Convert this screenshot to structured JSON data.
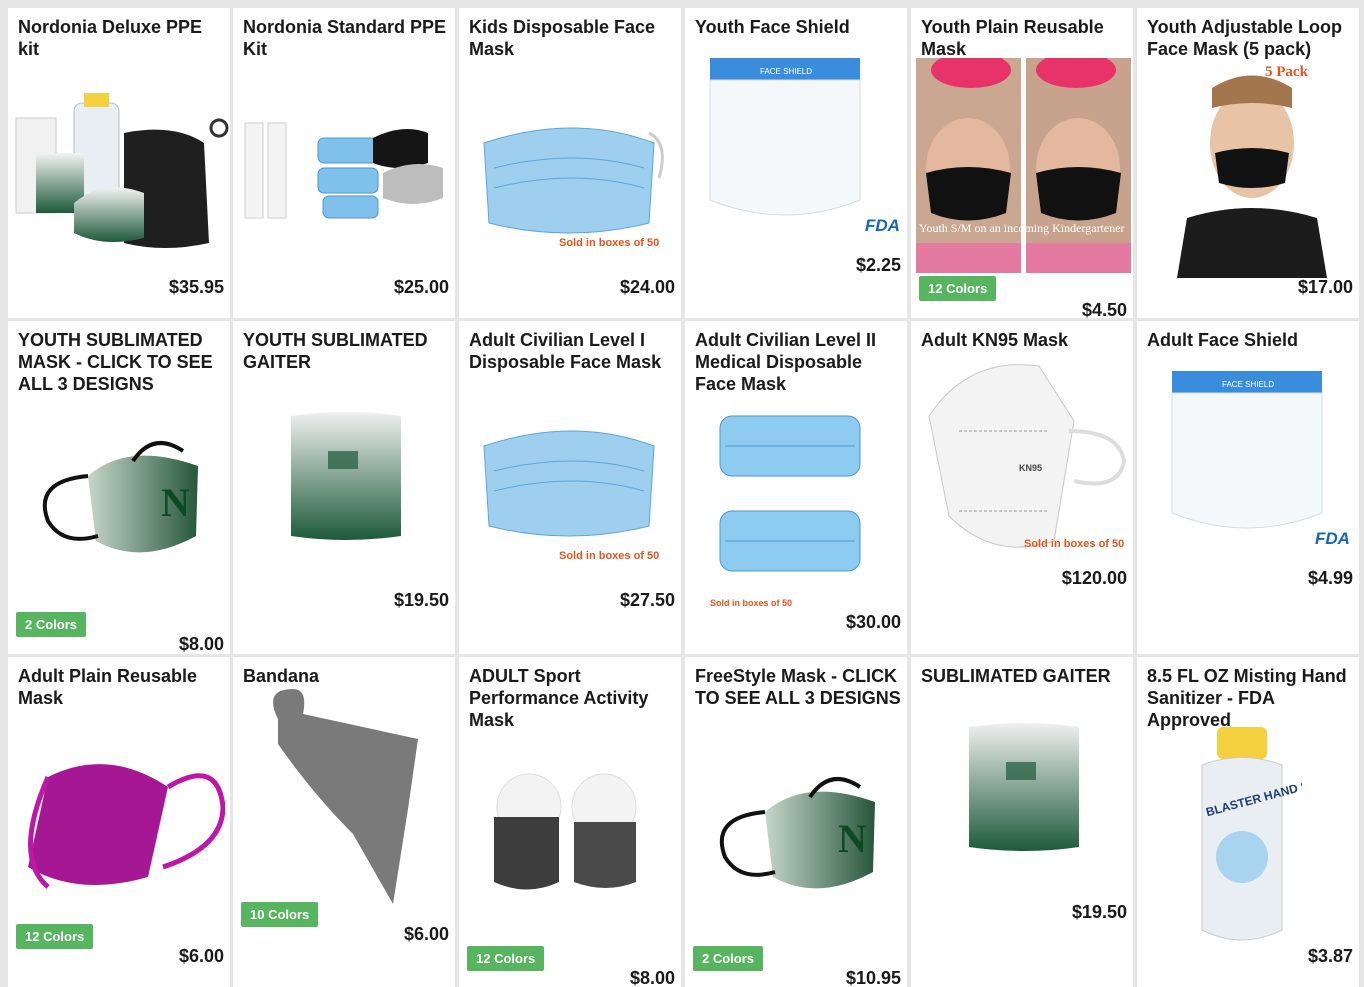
{
  "products": [
    {
      "title": "Nordonia Deluxe PPE kit",
      "price": "$35.95"
    },
    {
      "title": "Nordonia Standard PPE Kit",
      "price": "$25.00"
    },
    {
      "title": "Kids Disposable Face Mask",
      "price": "$24.00",
      "note": "Sold in boxes of 50"
    },
    {
      "title": "Youth Face Shield",
      "price": "$2.25",
      "label": "FACE SHIELD",
      "fda": "FDA"
    },
    {
      "title": "Youth Plain Reusable Mask",
      "price": "$4.50",
      "badge": "12 Colors",
      "caption": "Youth S/M on an incoming Kindergartener"
    },
    {
      "title": "Youth Adjustable Loop Face Mask (5 pack)",
      "price": "$17.00",
      "note": "5 Pack"
    },
    {
      "title": "YOUTH SUBLIMATED MASK - CLICK TO SEE ALL 3 DESIGNS",
      "price": "$8.00",
      "badge": "2 Colors"
    },
    {
      "title": "YOUTH SUBLIMATED GAITER",
      "price": "$19.50"
    },
    {
      "title": "Adult Civilian Level I Disposable Face Mask",
      "price": "$27.50",
      "note": "Sold in boxes of 50"
    },
    {
      "title": "Adult Civilian Level II Medical Disposable Face Mask",
      "price": "$30.00",
      "note": "Sold in boxes of 50"
    },
    {
      "title": "Adult KN95 Mask",
      "price": "$120.00",
      "note": "Sold in boxes of 50",
      "label": "KN95"
    },
    {
      "title": "Adult Face Shield",
      "price": "$4.99",
      "label": "FACE SHIELD",
      "fda": "FDA"
    },
    {
      "title": "Adult Plain Reusable Mask",
      "price": "$6.00",
      "badge": "12 Colors"
    },
    {
      "title": "Bandana",
      "price": "$6.00",
      "badge": "10 Colors"
    },
    {
      "title": "ADULT Sport Performance Activity Mask",
      "price": "$8.00",
      "badge": "12 Colors"
    },
    {
      "title": "FreeStyle Mask - CLICK TO SEE ALL 3 DESIGNS",
      "price": "$10.95",
      "badge": "2 Colors"
    },
    {
      "title": "SUBLIMATED GAITER",
      "price": "$19.50"
    },
    {
      "title": "8.5 FL OZ Misting Hand Sanitizer - FDA Approved",
      "price": "$3.87",
      "label": "BLASTER HAND SANITIZER"
    }
  ]
}
